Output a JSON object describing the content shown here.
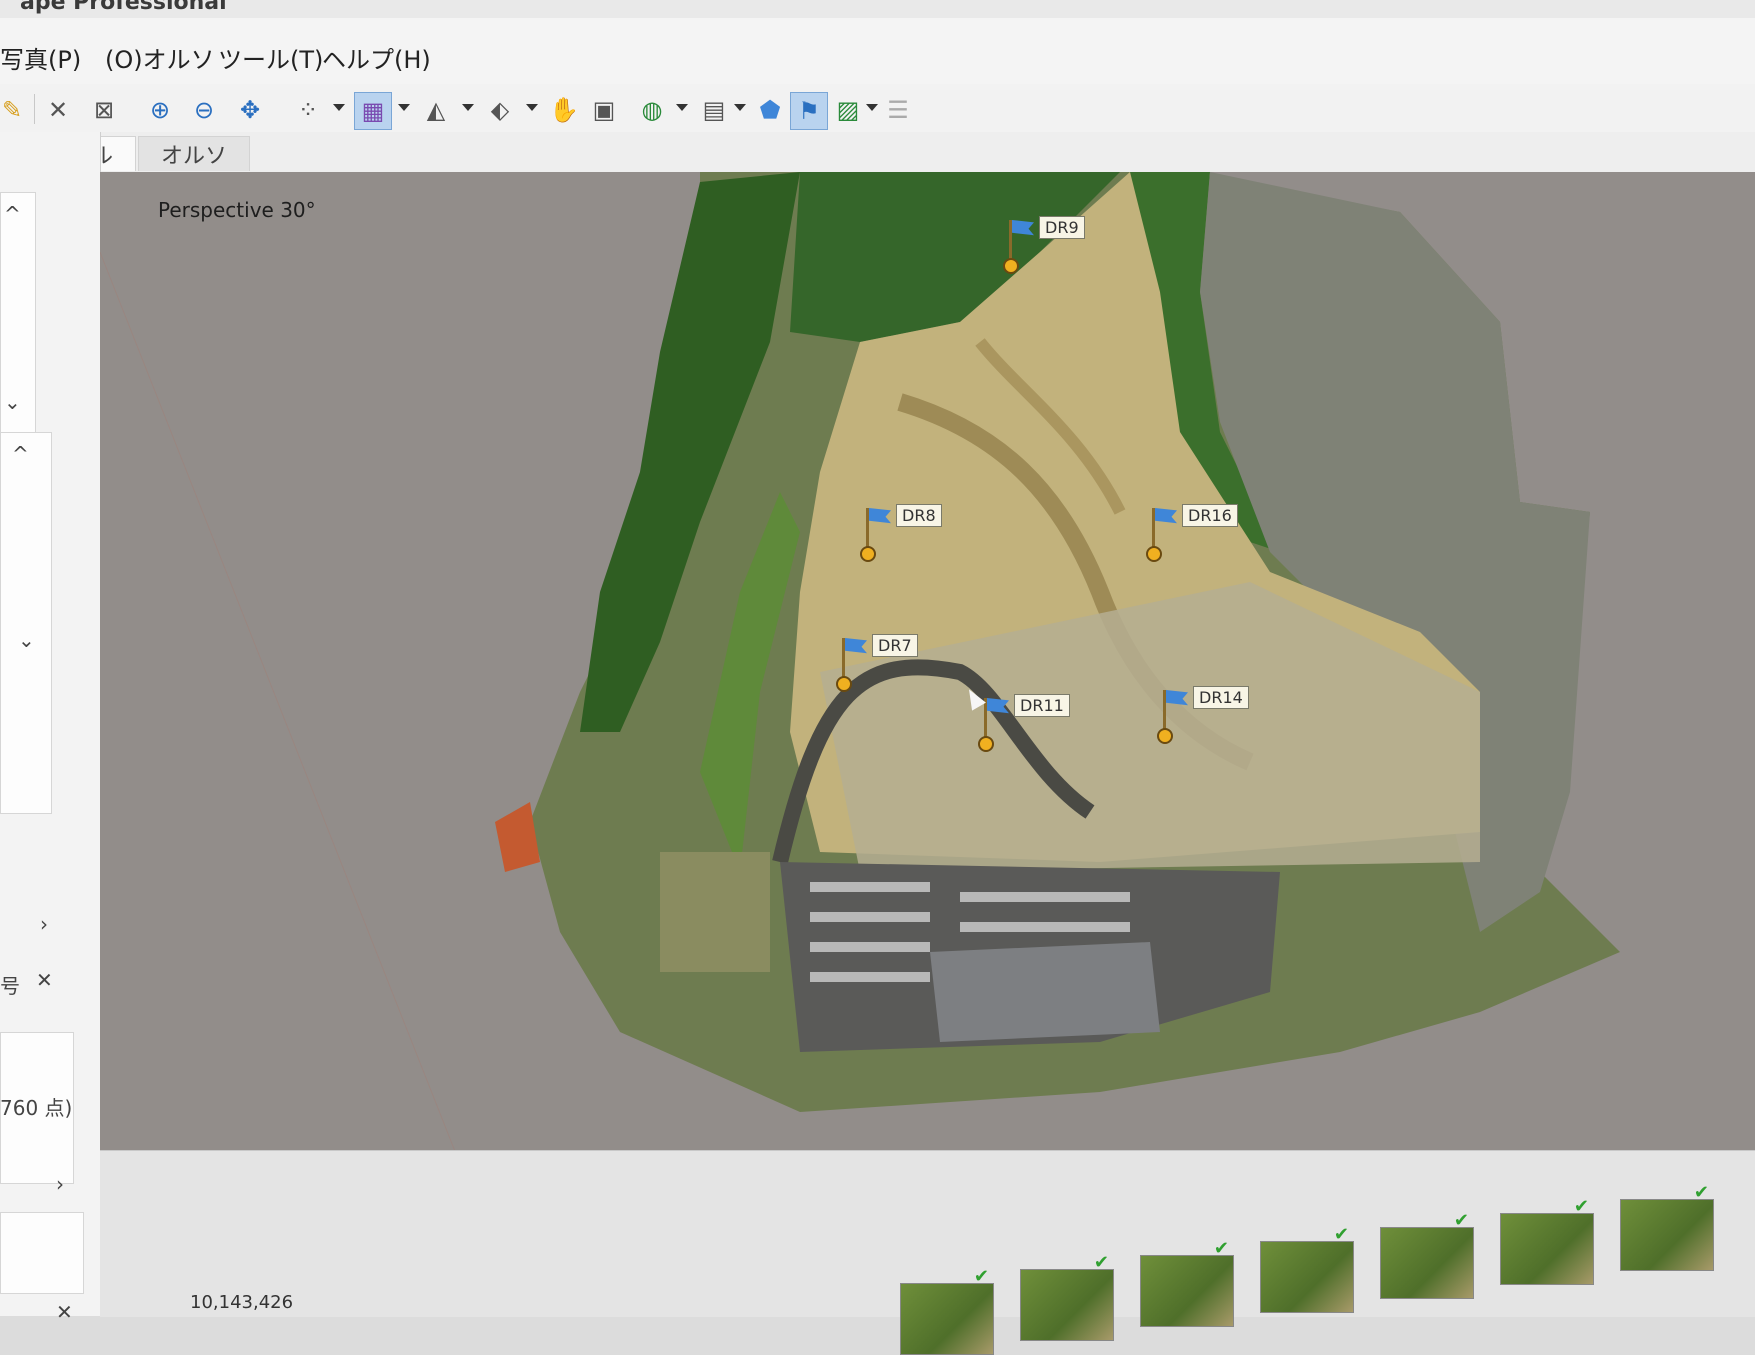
{
  "window": {
    "title": "ape Professional"
  },
  "menu": [
    {
      "label": "写真(P)"
    },
    {
      "label": "(O)オルソ"
    },
    {
      "label": "ツール(T)"
    },
    {
      "label": "ヘルプ(H)"
    }
  ],
  "toolbar": {
    "icons": [
      "pencil-icon",
      "cross-icon",
      "crop-icon",
      "zoom-in-icon",
      "zoom-out-icon",
      "move-icon",
      "points-icon",
      "grid-icon",
      "pyramid-icon",
      "plane-icon",
      "hand-icon",
      "doc-icon",
      "globe-icon",
      "camera-icon",
      "shield-icon",
      "flag-icon",
      "image-icon",
      "stack-icon"
    ],
    "active": "flag-icon"
  },
  "tabs": [
    {
      "label": "モデル",
      "active": true
    },
    {
      "label": "オルソ",
      "active": false
    }
  ],
  "viewport": {
    "projection_label": "Perspective 30°"
  },
  "markers": [
    {
      "id": "DR9"
    },
    {
      "id": "DR8"
    },
    {
      "id": "DR16"
    },
    {
      "id": "DR7"
    },
    {
      "id": "DR11"
    },
    {
      "id": "DR14"
    }
  ],
  "sidepanel": {
    "point_count_fragment": "760 点)",
    "fragment_label": "号"
  },
  "status": {
    "value_fragment": "10,143,426"
  },
  "colors": {
    "viewport_bg": "#928d8a",
    "flag": "#3f86d8",
    "marker_dot": "#f0b020",
    "active_tool": "#b9d3ef"
  }
}
